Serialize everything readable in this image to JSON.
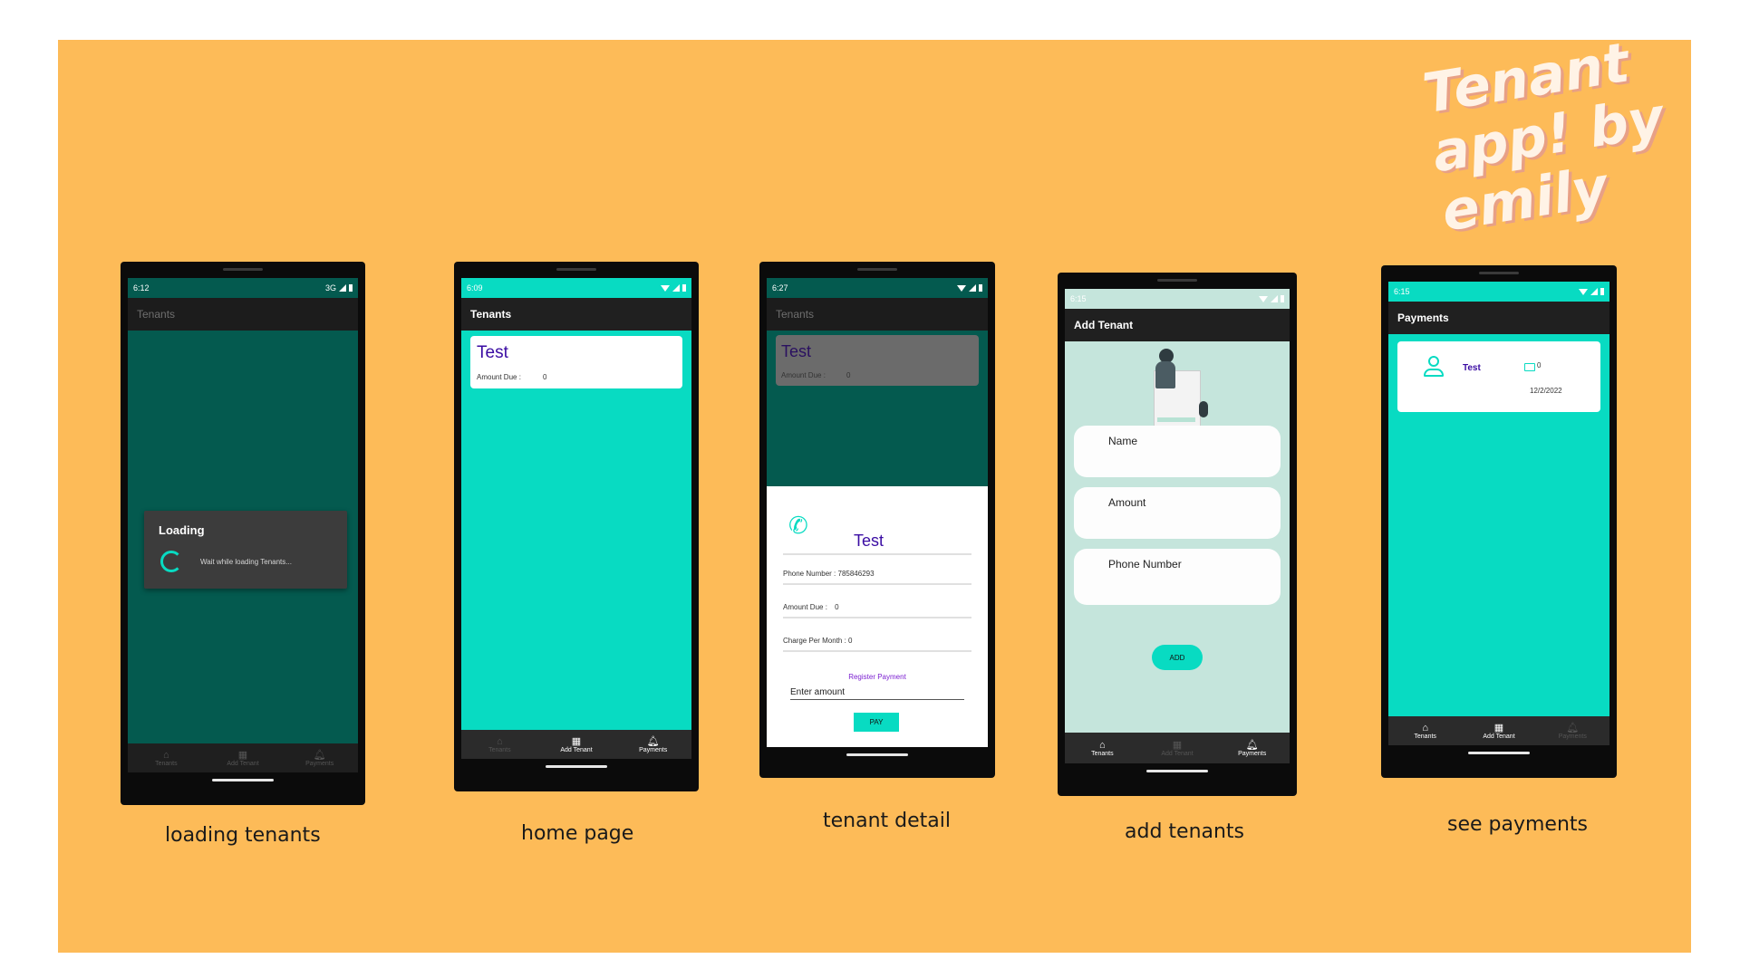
{
  "title": "Tenant app! by emily",
  "screens": {
    "loading": {
      "time": "6:12",
      "network": "3G",
      "app_title": "Tenants",
      "dialog_title": "Loading",
      "dialog_message": "Wait while loading Tenants...",
      "nav": [
        "Tenants",
        "Add Tenant",
        "Payments"
      ],
      "caption": "loading tenants"
    },
    "home": {
      "time": "6:09",
      "app_title": "Tenants",
      "tenant_name": "Test",
      "amount_label": "Amount Due :",
      "amount_value": "0",
      "nav": [
        "Tenants",
        "Add Tenant",
        "Payments"
      ],
      "caption": "home page"
    },
    "detail": {
      "time": "6:27",
      "app_title": "Tenants",
      "tenant_name": "Test",
      "amount_label": "Amount Due :",
      "amount_value": "0",
      "sheet_name": "Test",
      "phone_label": "Phone Number :",
      "phone_value": "785846293",
      "due_label": "Amount Due :",
      "due_value": "0",
      "charge_label": "Charge Per Month :",
      "charge_value": "0",
      "register_label": "Register Payment",
      "amount_placeholder": "Enter amount",
      "pay_label": "PAY",
      "caption": "tenant detail"
    },
    "add": {
      "time": "6:15",
      "app_title": "Add Tenant",
      "name_label": "Name",
      "amount_label": "Amount",
      "phone_label": "Phone Number",
      "add_label": "ADD",
      "nav": [
        "Tenants",
        "Add Tenant",
        "Payments"
      ],
      "caption": "add tenants"
    },
    "payments": {
      "time": "6:15",
      "app_title": "Payments",
      "tenant_name": "Test",
      "amount": "0",
      "date": "12/2/2022",
      "nav": [
        "Tenants",
        "Add Tenant",
        "Payments"
      ],
      "caption": "see  payments"
    }
  },
  "colors": {
    "background": "#fdbb58",
    "teal": "#08dbc2",
    "dark_teal": "#045a4f",
    "purple_text": "#3a0ca3",
    "mint": "#c5e5dc"
  }
}
